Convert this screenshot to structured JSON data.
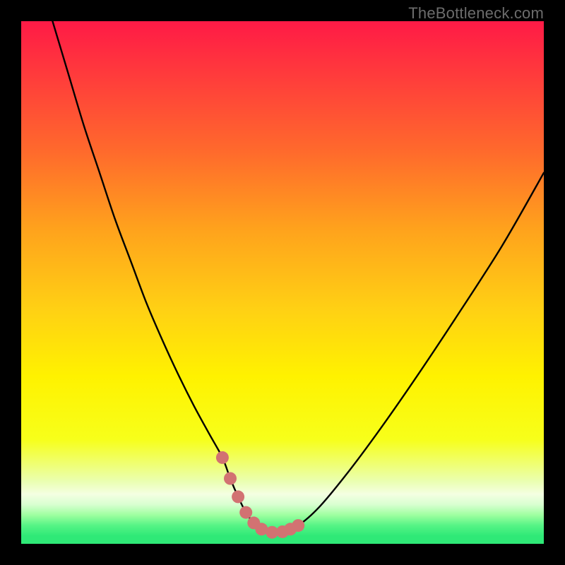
{
  "watermark": "TheBottleneck.com",
  "colors": {
    "frame": "#000000",
    "curve": "#000000",
    "marker_fill": "#d27272",
    "green": "#2fe977"
  },
  "gradient_stops": [
    {
      "offset": 0.0,
      "color": "#ff1a46"
    },
    {
      "offset": 0.1,
      "color": "#ff3a3c"
    },
    {
      "offset": 0.25,
      "color": "#ff6a2c"
    },
    {
      "offset": 0.4,
      "color": "#ffa31c"
    },
    {
      "offset": 0.55,
      "color": "#ffd014"
    },
    {
      "offset": 0.68,
      "color": "#fff200"
    },
    {
      "offset": 0.8,
      "color": "#f7ff1a"
    },
    {
      "offset": 0.88,
      "color": "#eaffb0"
    },
    {
      "offset": 0.905,
      "color": "#f4ffe2"
    },
    {
      "offset": 0.925,
      "color": "#d8ffd0"
    },
    {
      "offset": 0.945,
      "color": "#9effa0"
    },
    {
      "offset": 0.965,
      "color": "#55f485"
    },
    {
      "offset": 0.985,
      "color": "#2fe977"
    },
    {
      "offset": 1.0,
      "color": "#2fe977"
    }
  ],
  "chart_data": {
    "type": "line",
    "title": "",
    "xlabel": "",
    "ylabel": "",
    "xlim": [
      0,
      100
    ],
    "ylim": [
      0,
      100
    ],
    "series": [
      {
        "name": "bottleneck-curve",
        "x": [
          6,
          9,
          12,
          15,
          18,
          21,
          24,
          27,
          30,
          33,
          36,
          38.5,
          40,
          41.5,
          43,
          44.5,
          46,
          48,
          50,
          53,
          57,
          62,
          68,
          75,
          83,
          92,
          100
        ],
        "y": [
          100,
          90,
          80,
          71,
          62,
          54,
          46,
          39,
          32.5,
          26.5,
          21,
          16.5,
          12.5,
          9,
          6,
          4,
          2.8,
          2.2,
          2.3,
          3.5,
          7,
          13,
          21,
          31,
          43,
          57,
          71
        ]
      }
    ],
    "markers": {
      "name": "highlight-dots",
      "x": [
        38.5,
        40,
        41.5,
        43,
        44.5,
        46,
        48,
        50,
        51.5,
        53
      ],
      "y": [
        16.5,
        12.5,
        9,
        6,
        4,
        2.8,
        2.2,
        2.3,
        2.8,
        3.5
      ],
      "r": 9
    }
  }
}
